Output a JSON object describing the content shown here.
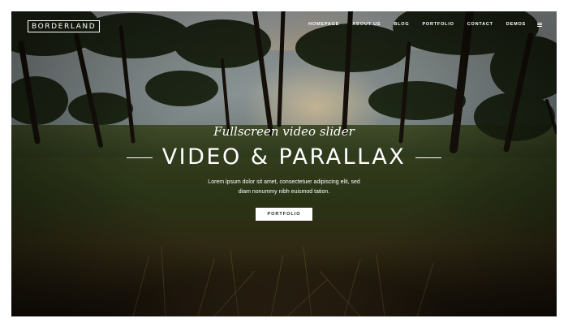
{
  "brand": {
    "logo_text": "BORDERLAND"
  },
  "nav": {
    "items": [
      {
        "label": "HOMEPAGE"
      },
      {
        "label": "ABOUT US"
      },
      {
        "label": "BLOG"
      },
      {
        "label": "PORTFOLIO"
      },
      {
        "label": "CONTACT"
      },
      {
        "label": "DEMOS"
      }
    ],
    "menu_icon": "hamburger-icon"
  },
  "hero": {
    "subtitle": "Fullscreen video slider",
    "title": "VIDEO & PARALLAX",
    "description_line1": "Lorem ipsum dolor sit amet, consectetuer adipiscing elit, sed",
    "description_line2": "diam nonummy nibh euismod tation.",
    "button_label": "PORTFOLIO"
  },
  "background": {
    "scene": "forest-lake-sunset",
    "accent_color": "#ffffff"
  }
}
